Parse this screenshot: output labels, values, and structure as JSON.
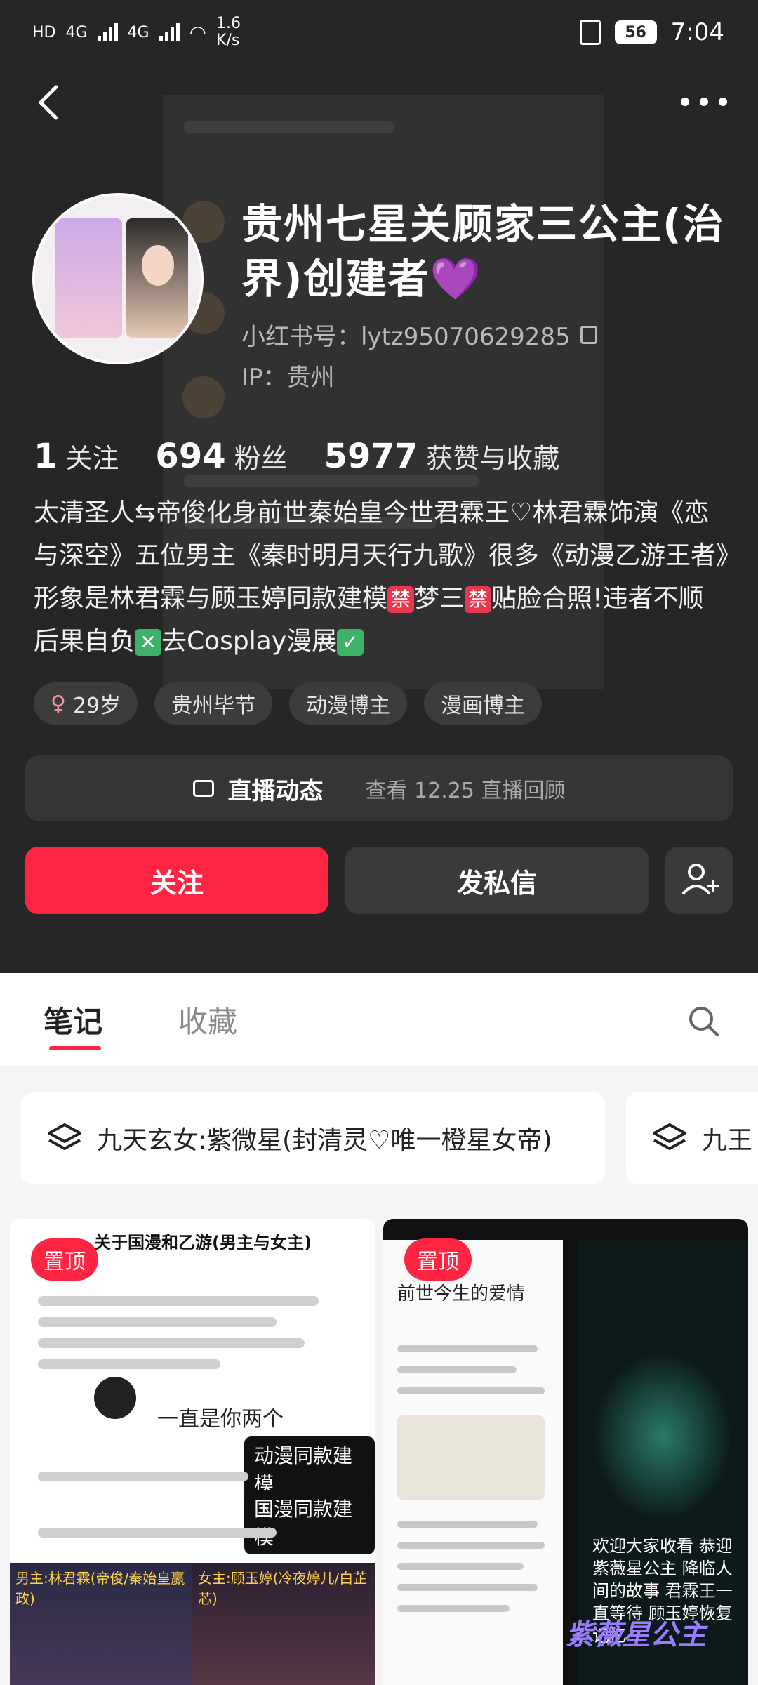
{
  "status": {
    "left_indicators": [
      "HD",
      "4G",
      "4G"
    ],
    "speed": "1.6\nK/s",
    "battery": "56",
    "time": "7:04"
  },
  "profile": {
    "name": "贵州七星关顾家三公主(治界)创建者💜",
    "redbook_id": "小红书号：lytz95070629285",
    "ip": "IP：贵州",
    "stats": [
      {
        "num": "1",
        "label": "关注"
      },
      {
        "num": "694",
        "label": "粉丝"
      },
      {
        "num": "5977",
        "label": "获赞与收藏"
      }
    ],
    "bio": {
      "part1": "太清圣人⇆帝俊化身前世秦始皇今世君霖王♡林君霖饰演《恋与深空》五位男主《秦时明月天行九歌》很多《动漫乙游王者》形象是林君霖与顾玉婷同款建模",
      "ban": "禁",
      "part2": "梦三",
      "part3": "贴脸合照!违者不顺后果自负",
      "cross": "✕",
      "part4": "去Cosplay漫展",
      "check": "✓"
    },
    "tags": [
      "29岁",
      "贵州毕节",
      "动漫博主",
      "漫画博主"
    ]
  },
  "live": {
    "title": "直播动态",
    "sub": "查看 12.25 直播回顾"
  },
  "buttons": {
    "follow": "关注",
    "message": "发私信"
  },
  "tabs": [
    "笔记",
    "收藏"
  ],
  "collections": [
    "九天玄女:紫微星(封清灵♡唯一橙星女帝)",
    "九王"
  ],
  "notes": [
    {
      "pin": "置顶",
      "top_text": "关于国漫和乙游(男主与女主)",
      "mid_text": "一直是你两个",
      "bubble1": "动漫同款建模",
      "bubble2": "国漫同款建模",
      "bottom_left": "男主:林君霖(帝俊/秦始皇嬴政)",
      "bottom_right": "女主:顾玉婷(冷夜婷儿/白芷芯)"
    },
    {
      "pin": "置顶",
      "title": "前世今生的爱情",
      "caption": "欢迎大家收看 恭迎紫薇星公主 降临人间的故事 君霖王一直等待 顾玉婷恢复记忆",
      "purple": "紫薇星公主"
    }
  ],
  "colors": {
    "accent": "#ff2442",
    "dark_bg": "#262626",
    "panel": "#363636"
  }
}
